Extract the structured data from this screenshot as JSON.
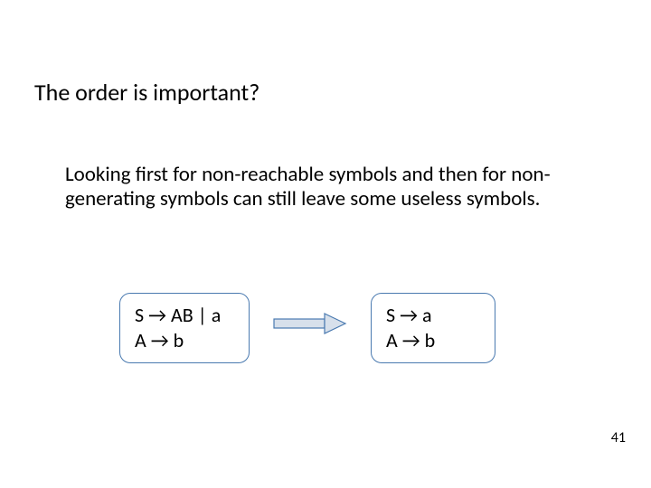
{
  "title": "The order is important?",
  "body": "Looking first for non-reachable symbols and then for non-generating symbols can still leave some useless symbols.",
  "grammar_left": {
    "line1": "S → AB | a",
    "line2": "A → b"
  },
  "grammar_right": {
    "line1": "S → a",
    "line2": "A → b"
  },
  "page_number": "41"
}
